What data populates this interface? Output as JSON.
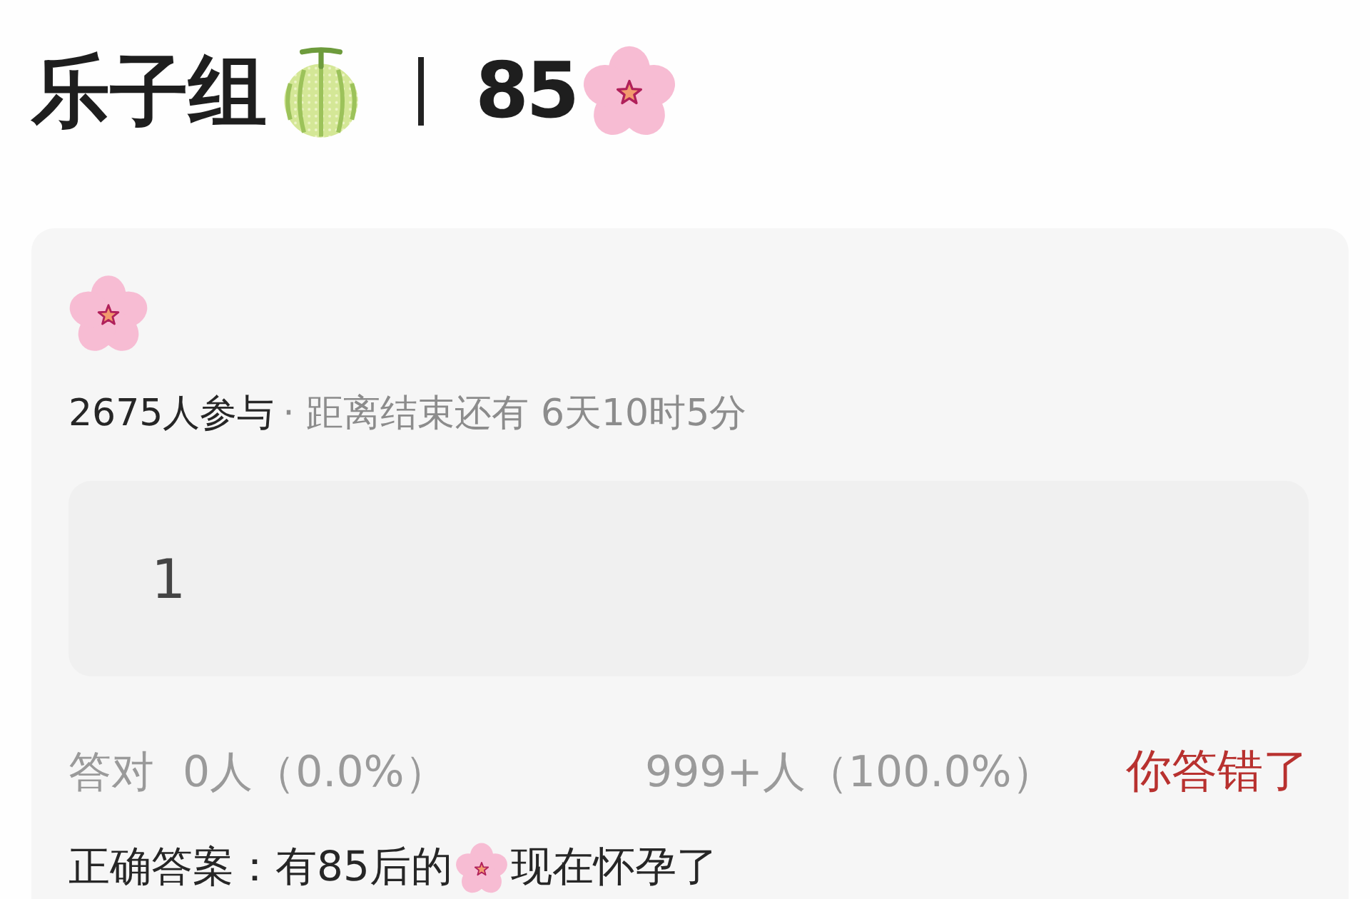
{
  "title": {
    "text": "乐子组",
    "number": "85"
  },
  "quiz": {
    "participants": "2675人参与",
    "countdown": "· 距离结束还有 6天10时5分",
    "options": [
      {
        "text": "1"
      }
    ],
    "stats": {
      "correct_label": "答对",
      "correct_count": "0人（0.0%）",
      "wrong_count": "999+人（100.0%）"
    },
    "verdict": {
      "text": "你答错了",
      "correct": false
    },
    "correct_answer": {
      "label": "正确答案：",
      "segments": [
        {
          "kind": "text",
          "text": "有85后的"
        },
        {
          "kind": "emoji"
        },
        {
          "kind": "text",
          "text": "现在怀孕了"
        }
      ]
    }
  }
}
